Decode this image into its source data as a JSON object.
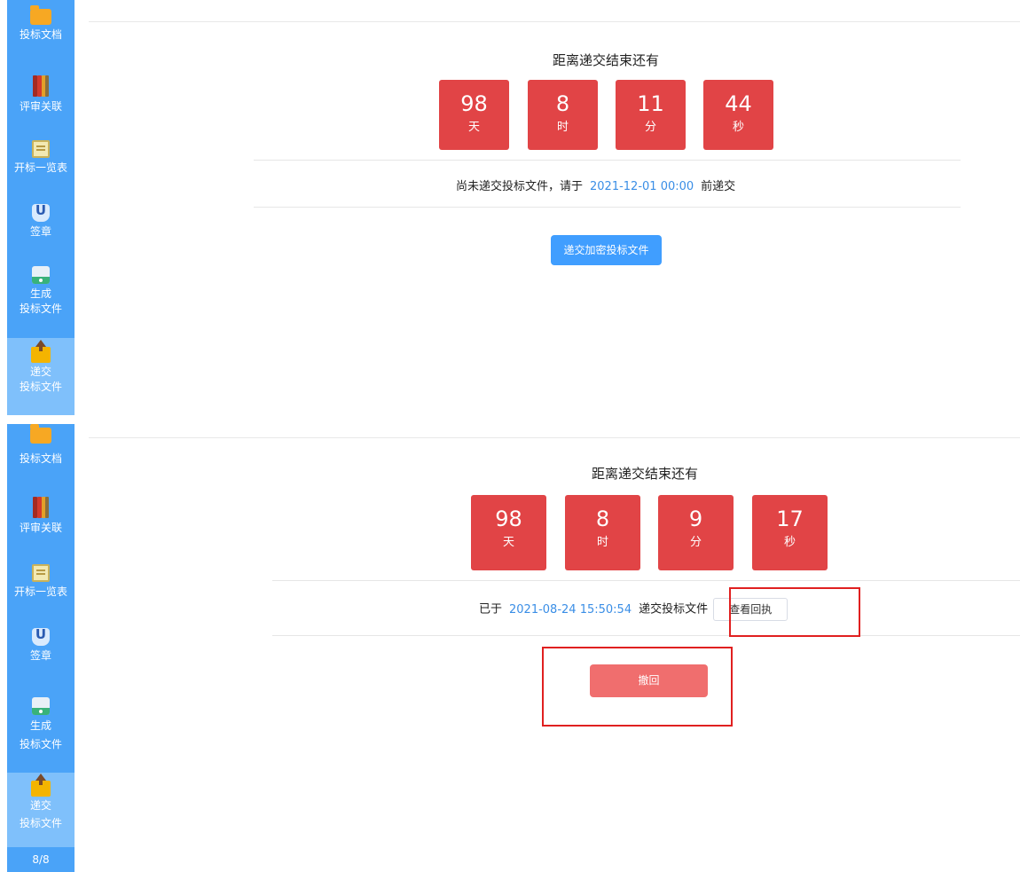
{
  "sidebar": {
    "items": [
      {
        "label": "投标文档",
        "icon": "folder-icon"
      },
      {
        "label": "评审关联",
        "icon": "books-icon"
      },
      {
        "label": "开标一览表",
        "icon": "box-icon"
      },
      {
        "label": "签章",
        "icon": "seal-icon"
      },
      {
        "label": "生成\n投标文件",
        "label_line1": "生成",
        "label_line2": "投标文件",
        "icon": "disk-icon"
      },
      {
        "label_line1": "递交",
        "label_line2": "投标文件",
        "icon": "upload-icon",
        "active": true
      }
    ],
    "page_indicator": "8/8"
  },
  "panel_a": {
    "title": "距离递交结束还有",
    "countdown": [
      {
        "value": "98",
        "unit": "天"
      },
      {
        "value": "8",
        "unit": "时"
      },
      {
        "value": "11",
        "unit": "分"
      },
      {
        "value": "44",
        "unit": "秒"
      }
    ],
    "info_prefix": "尚未递交投标文件，请于",
    "deadline": "2021-12-01 00:00",
    "info_suffix": "前递交",
    "submit_button": "递交加密投标文件"
  },
  "panel_b": {
    "title": "距离递交结束还有",
    "countdown": [
      {
        "value": "98",
        "unit": "天"
      },
      {
        "value": "8",
        "unit": "时"
      },
      {
        "value": "9",
        "unit": "分"
      },
      {
        "value": "17",
        "unit": "秒"
      }
    ],
    "info_prefix": "已于",
    "submitted_at": "2021-08-24 15:50:54",
    "info_suffix": "递交投标文件",
    "receipt_button": "查看回执",
    "withdraw_button": "撤回"
  },
  "colors": {
    "sidebar_bg": "#4aa3f8",
    "sidebar_active": "#7fc0fb",
    "countdown_bg": "#e14446",
    "link_blue": "#3a8ee6",
    "primary_button": "#409eff",
    "withdraw_button": "#f06e6e",
    "highlight_box": "#e02020"
  }
}
